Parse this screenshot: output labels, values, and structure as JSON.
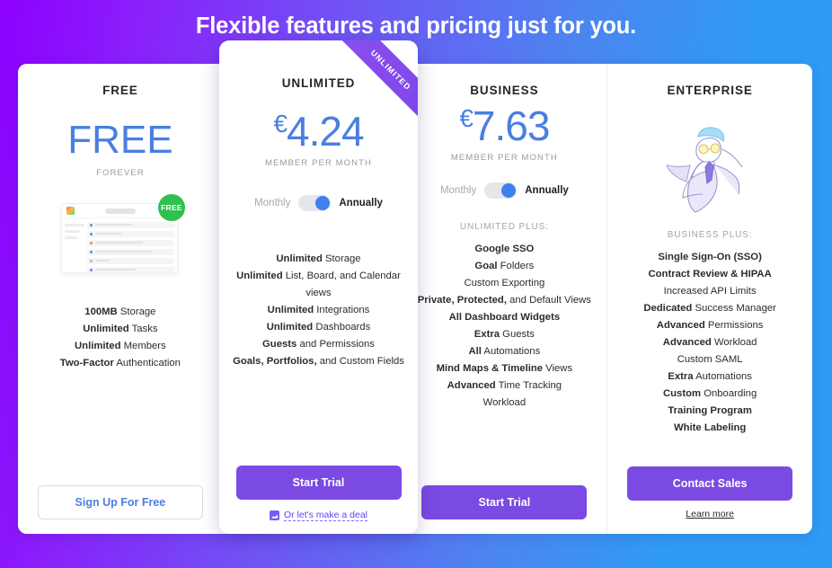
{
  "page": {
    "title": "Flexible features and pricing just for you.",
    "accent_purple": "#7b4ae2",
    "accent_blue": "#4a7fe0",
    "bg_from": "#8c00ff",
    "bg_to": "#2f9bf5"
  },
  "plans": {
    "free": {
      "name": "FREE",
      "price_word": "FREE",
      "period": "FOREVER",
      "badge": "FREE",
      "features": [
        {
          "bold": "100MB",
          "rest": " Storage"
        },
        {
          "bold": "Unlimited",
          "rest": " Tasks"
        },
        {
          "bold": "Unlimited",
          "rest": " Members"
        },
        {
          "bold": "Two-Factor",
          "rest": " Authentication"
        }
      ],
      "cta": "Sign Up For Free"
    },
    "unlimited": {
      "ribbon": "UNLIMITED",
      "name": "UNLIMITED",
      "currency": "€",
      "price": "4.24",
      "period": "MEMBER PER MONTH",
      "toggle": {
        "left": "Monthly",
        "right": "Annually",
        "selected": "Annually"
      },
      "features": [
        {
          "bold": "Unlimited",
          "rest": " Storage"
        },
        {
          "bold": "Unlimited",
          "rest": " List, Board, and Calendar"
        },
        {
          "bold": "",
          "rest": "views"
        },
        {
          "bold": "Unlimited",
          "rest": " Integrations"
        },
        {
          "bold": "Unlimited",
          "rest": " Dashboards"
        },
        {
          "bold": "Guests",
          "rest": " and Permissions"
        },
        {
          "bold": "Goals, Portfolios,",
          "rest": " and Custom Fields"
        }
      ],
      "cta": "Start Trial",
      "deal_link": "Or let's make a deal",
      "deal_icon": "deal-tag-icon"
    },
    "business": {
      "name": "BUSINESS",
      "currency": "€",
      "price": "7.63",
      "period": "MEMBER PER MONTH",
      "toggle": {
        "left": "Monthly",
        "right": "Annually",
        "selected": "Annually"
      },
      "plus_head": "UNLIMITED PLUS:",
      "features": [
        {
          "bold": "Google SSO",
          "rest": ""
        },
        {
          "bold": "Goal",
          "rest": " Folders"
        },
        {
          "bold": "",
          "rest": "Custom Exporting"
        },
        {
          "bold": "Private, Protected,",
          "rest": " and Default Views"
        },
        {
          "bold": "All Dashboard Widgets",
          "rest": ""
        },
        {
          "bold": "Extra",
          "rest": " Guests"
        },
        {
          "bold": "All",
          "rest": " Automations"
        },
        {
          "bold": "Mind Maps & Timeline",
          "rest": " Views"
        },
        {
          "bold": "Advanced",
          "rest": " Time Tracking"
        },
        {
          "bold": "",
          "rest": "Workload"
        }
      ],
      "cta": "Start Trial"
    },
    "enterprise": {
      "name": "ENTERPRISE",
      "illustration": "superhero-businessman-illustration",
      "plus_head": "BUSINESS PLUS:",
      "features": [
        {
          "bold": "Single Sign-On (SSO)",
          "rest": ""
        },
        {
          "bold": "Contract Review & HIPAA",
          "rest": ""
        },
        {
          "bold": "",
          "rest": "Increased API Limits"
        },
        {
          "bold": "Dedicated",
          "rest": " Success Manager"
        },
        {
          "bold": "Advanced",
          "rest": " Permissions"
        },
        {
          "bold": "Advanced",
          "rest": " Workload"
        },
        {
          "bold": "",
          "rest": "Custom SAML"
        },
        {
          "bold": "Extra",
          "rest": " Automations"
        },
        {
          "bold": "Custom",
          "rest": " Onboarding"
        },
        {
          "bold": "Training Program",
          "rest": ""
        },
        {
          "bold": "White Labeling",
          "rest": ""
        }
      ],
      "cta": "Contact Sales",
      "sub_link": "Learn more"
    }
  }
}
